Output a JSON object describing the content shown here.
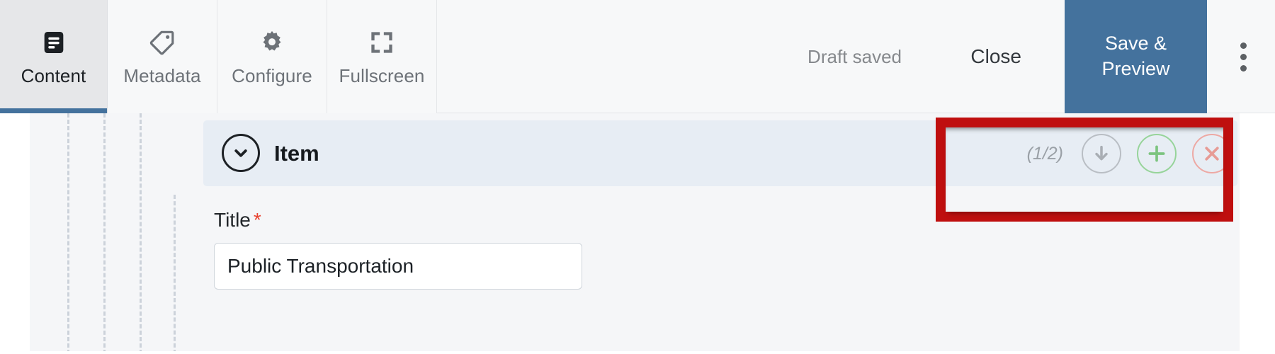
{
  "toolbar": {
    "tabs": [
      {
        "label": "Content",
        "icon": "content-icon",
        "active": true
      },
      {
        "label": "Metadata",
        "icon": "tag-icon",
        "active": false
      },
      {
        "label": "Configure",
        "icon": "gear-icon",
        "active": false
      },
      {
        "label": "Fullscreen",
        "icon": "fullscreen-icon",
        "active": false
      }
    ],
    "status_text": "Draft saved",
    "close_label": "Close",
    "save_preview_line1": "Save &",
    "save_preview_line2": "Preview",
    "overflow_icon": "kebab-menu-icon",
    "accent_color": "#44729d"
  },
  "item_panel": {
    "title": "Item",
    "collapse_icon": "chevron-down-icon",
    "counter": "(1/2)",
    "actions": [
      {
        "name": "move-down-button",
        "icon": "arrow-down-circle-icon",
        "color": "#b9bec4"
      },
      {
        "name": "add-item-button",
        "icon": "plus-circle-icon",
        "color": "#97d49a"
      },
      {
        "name": "remove-item-button",
        "icon": "close-circle-icon",
        "color": "#eda9a4"
      }
    ],
    "header_color": "#e7edf4"
  },
  "title_field": {
    "label": "Title",
    "required_marker": "*",
    "value": "Public Transportation",
    "placeholder": ""
  },
  "annotation": {
    "highlight_color": "#bf0f0f"
  }
}
